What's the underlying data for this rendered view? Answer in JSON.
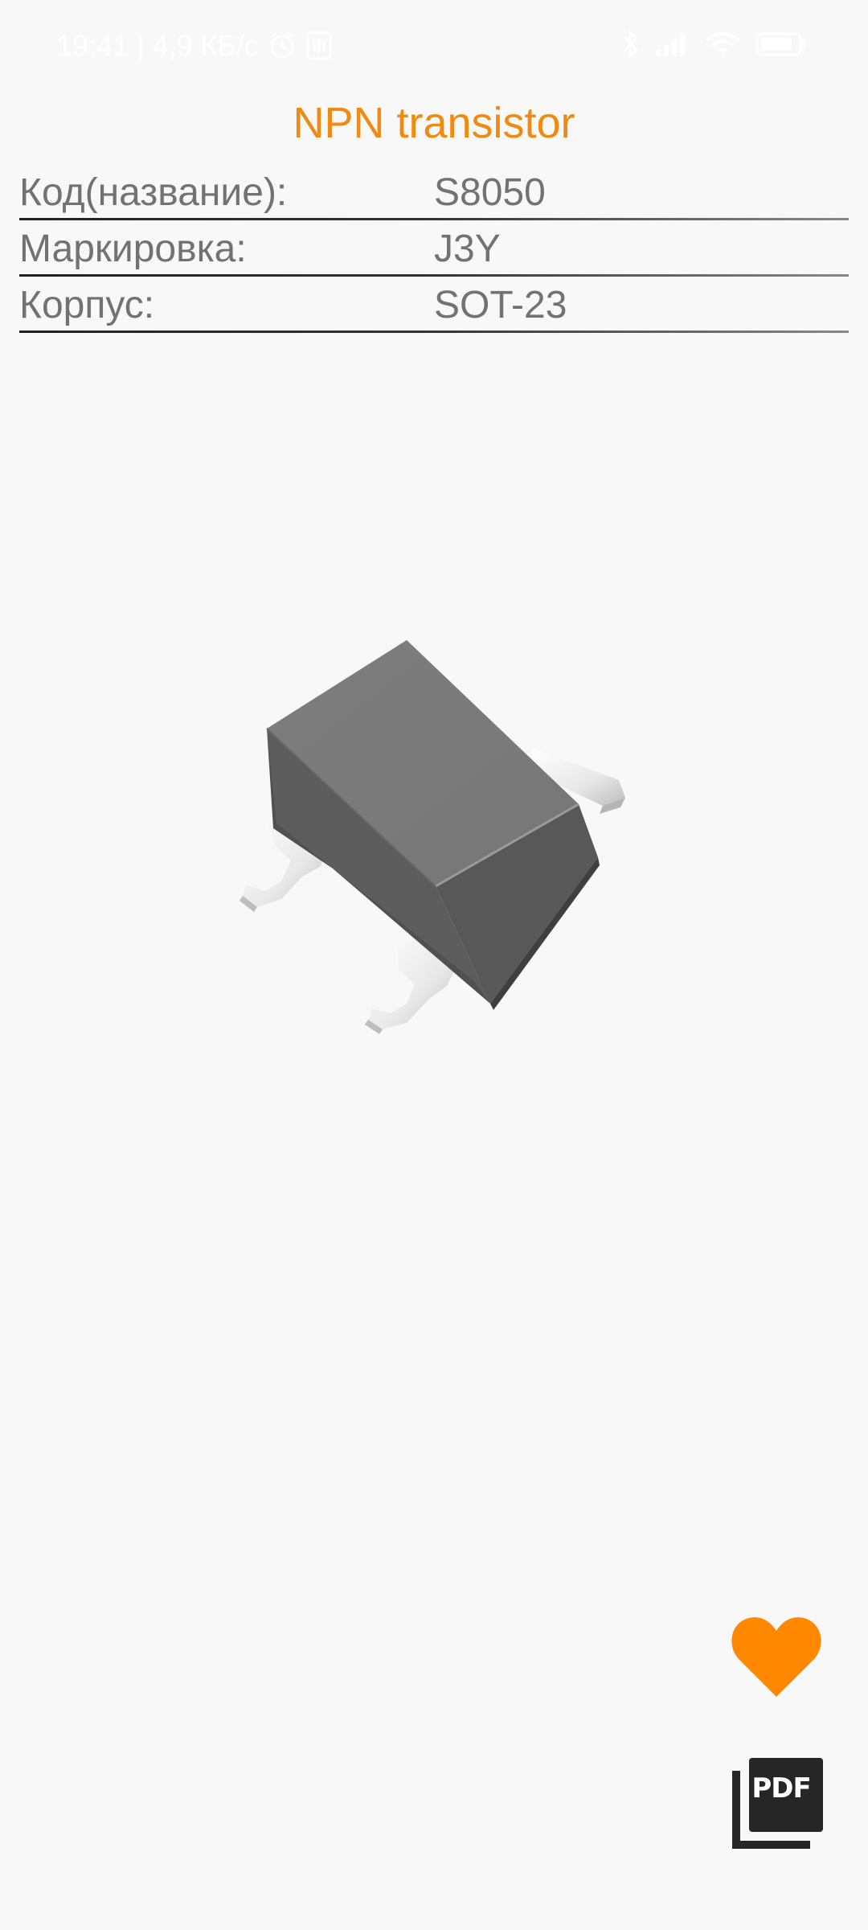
{
  "status_bar": {
    "time": "19:41",
    "separator": "|",
    "network_speed": "4,9 КБ/с",
    "icons": [
      "alarm-icon",
      "nfc-icon",
      "bluetooth-icon",
      "signal-icon",
      "wifi-icon",
      "battery-icon"
    ]
  },
  "title": "NPN transistor",
  "accent_color": "#f18a12",
  "specs": [
    {
      "label": "Код(название):",
      "value": "S8050"
    },
    {
      "label": "Маркировка:",
      "value": "J3Y"
    },
    {
      "label": "Корпус:",
      "value": "SOT-23"
    }
  ],
  "image": {
    "icon": "sot23-package-image"
  },
  "actions": {
    "favorite_icon": "heart-icon",
    "pdf_label": "PDF"
  }
}
